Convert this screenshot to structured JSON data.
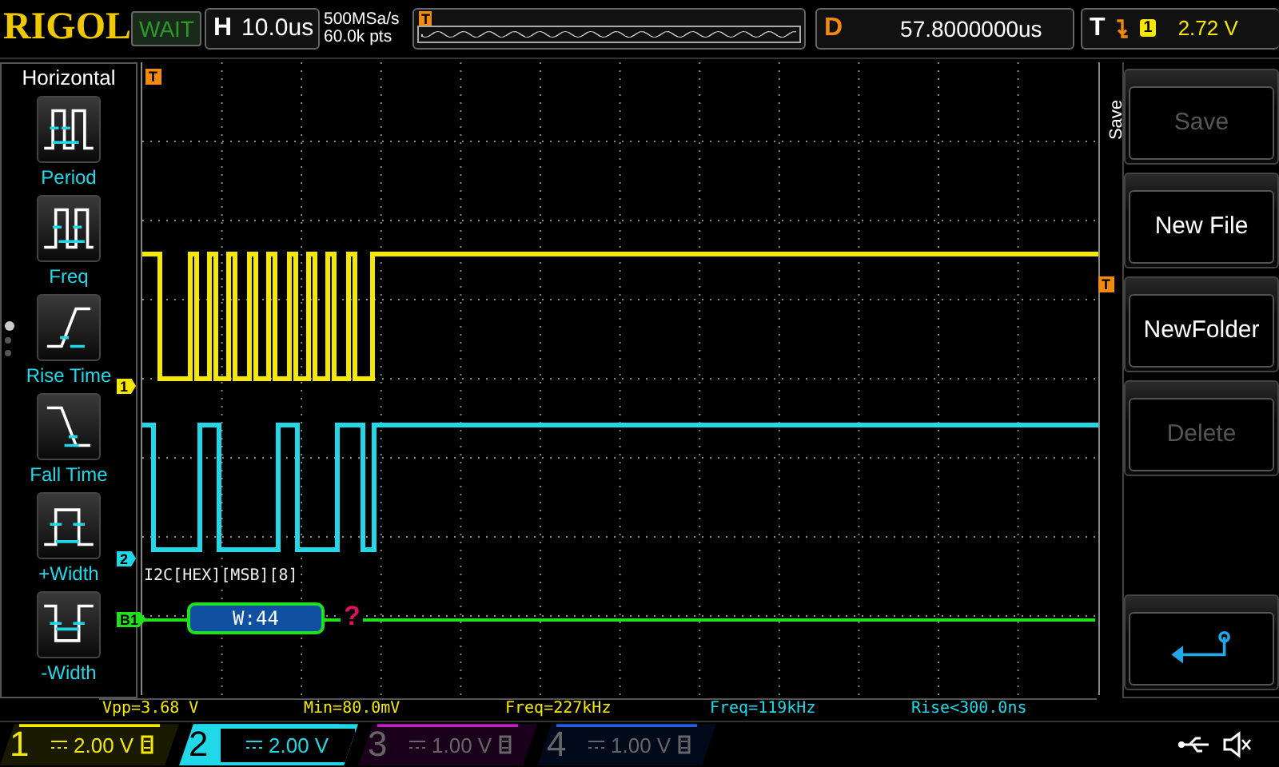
{
  "brand": "RIGOL",
  "run_status": "WAIT",
  "timebase": {
    "label": "H",
    "value": "10.0us"
  },
  "sample_rate": "500MSa/s",
  "memory_depth": "60.0k pts",
  "trigger_position_marker": "T",
  "delay": {
    "label": "D",
    "value": "57.8000000us"
  },
  "trigger": {
    "label": "T",
    "source": "1",
    "level": "2.72 V"
  },
  "measure_menu": {
    "title": "Horizontal",
    "items": [
      {
        "label": "Period",
        "kind": "period"
      },
      {
        "label": "Freq",
        "kind": "freq"
      },
      {
        "label": "Rise Time",
        "kind": "rise"
      },
      {
        "label": "Fall Time",
        "kind": "fall"
      },
      {
        "label": "+Width",
        "kind": "pwidth"
      },
      {
        "label": "-Width",
        "kind": "nwidth"
      }
    ],
    "page_dots": [
      {
        "selected": true
      },
      {
        "selected": false
      },
      {
        "selected": false
      }
    ]
  },
  "graph_markers": [
    {
      "label": "T",
      "kind": "trigger_time",
      "color": "#f08a10"
    },
    {
      "label": "1",
      "kind": "ch1",
      "color": "#f5e800"
    },
    {
      "label": "2",
      "kind": "ch2",
      "color": "#20d8e8"
    },
    {
      "label": "B1",
      "kind": "bus",
      "color": "#20e020"
    },
    {
      "label": "T",
      "kind": "trigger_level",
      "color": "#f08a10"
    }
  ],
  "decode": {
    "label": "I2C[HEX][MSB][8]",
    "frame": "W:44",
    "error": "?"
  },
  "measurements": [
    {
      "text": "Vpp=3.68 V",
      "color": "#f5e800"
    },
    {
      "text": "Min=80.0mV",
      "color": "#f5e800"
    },
    {
      "text": "Freq=227kHz",
      "color": "#f5e800"
    },
    {
      "text": "Freq=119kHz",
      "color": "#20d8e8"
    },
    {
      "text": "Rise<300.0ns",
      "color": "#20d8e8"
    }
  ],
  "save_menu": {
    "title": "Save",
    "buttons": [
      {
        "label": "Save",
        "disabled": true
      },
      {
        "label": "New File",
        "disabled": false
      },
      {
        "label": "NewFolder",
        "disabled": false
      },
      {
        "label": "Delete",
        "disabled": true
      }
    ]
  },
  "channels": [
    {
      "number": "1",
      "scale": "2.00 V",
      "selected": false,
      "enabled": true,
      "color": "#f5e800"
    },
    {
      "number": "2",
      "scale": "2.00 V",
      "selected": true,
      "enabled": true,
      "color": "#20d8e8"
    },
    {
      "number": "3",
      "scale": "1.00 V",
      "selected": false,
      "enabled": false,
      "color": "#c020c0"
    },
    {
      "number": "4",
      "scale": "1.00 V",
      "selected": false,
      "enabled": false,
      "color": "#2060e0"
    }
  ]
}
